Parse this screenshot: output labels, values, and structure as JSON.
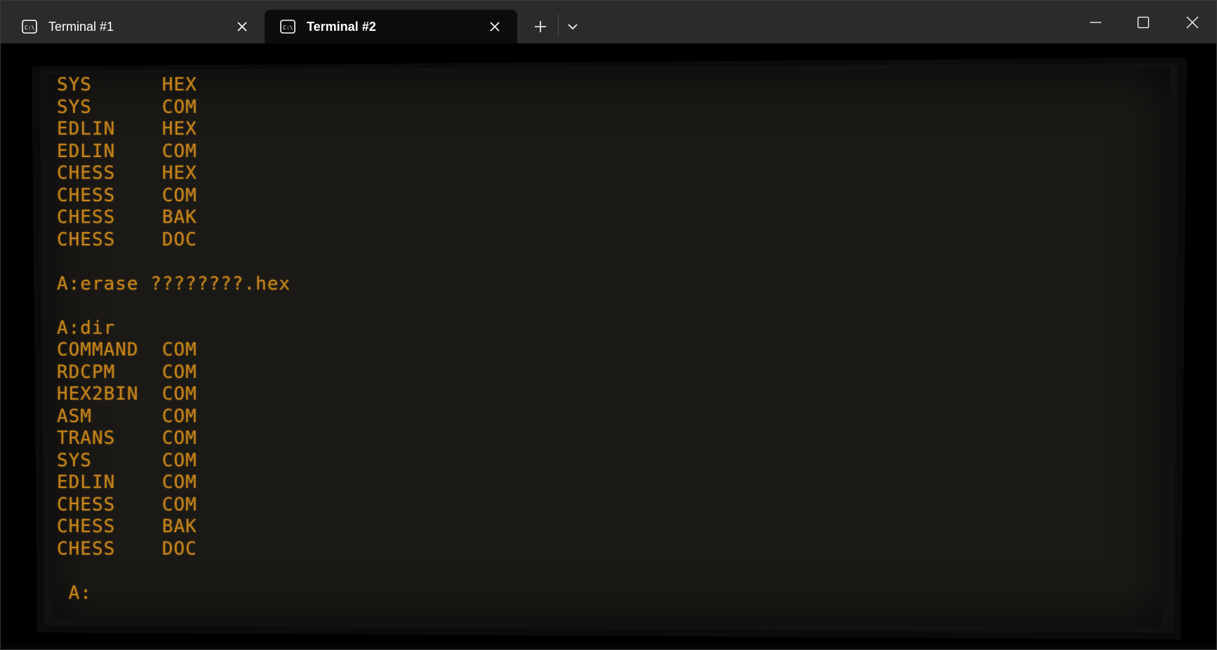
{
  "tabs": [
    {
      "label": "Terminal #1",
      "active": false
    },
    {
      "label": "Terminal #2",
      "active": true
    }
  ],
  "terminal": {
    "lines": [
      "SYS      HEX",
      "SYS      COM",
      "EDLIN    HEX",
      "EDLIN    COM",
      "CHESS    HEX",
      "CHESS    COM",
      "CHESS    BAK",
      "CHESS    DOC",
      "",
      "A:erase ????????.hex",
      "",
      "A:dir",
      "COMMAND  COM",
      "RDCPM    COM",
      "HEX2BIN  COM",
      "ASM      COM",
      "TRANS    COM",
      "SYS      COM",
      "EDLIN    COM",
      "CHESS    COM",
      "CHESS    BAK",
      "CHESS    DOC",
      "",
      " A:"
    ],
    "text_color": "#c8861a",
    "background_color": "#1c1a17"
  },
  "icons": {
    "tab_icon": "terminal-icon",
    "close": "close-icon",
    "new_tab": "plus-icon",
    "dropdown": "chevron-down-icon",
    "minimize": "minimize-icon",
    "maximize": "maximize-icon",
    "window_close": "window-close-icon"
  }
}
